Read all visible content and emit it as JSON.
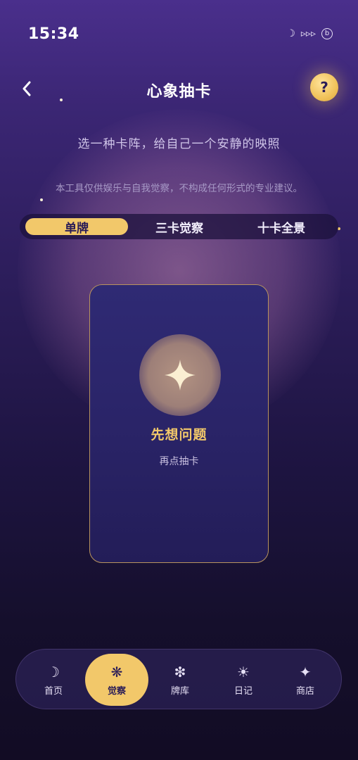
{
  "status_bar": {
    "time": "15:34",
    "icons": [
      "moon-icon",
      "signal-icon",
      "battery-icon"
    ],
    "battery_glyph": "b",
    "signal_glyph": "▹▹▹"
  },
  "header": {
    "title": "心象抽卡",
    "help_label": "?"
  },
  "subtitle": "选一种卡阵，给自己一个安静的映照",
  "disclaimer": "本工具仅供娱乐与自我觉察，不构成任何形式的专业建议。",
  "tabs": [
    {
      "label": "单牌",
      "active": true
    },
    {
      "label": "三卡觉察",
      "active": false
    },
    {
      "label": "十卡全景",
      "active": false
    }
  ],
  "card": {
    "title": "先想问题",
    "subtitle": "再点抽卡",
    "icon": "sparkle-icon"
  },
  "bottom_nav": [
    {
      "label": "首页",
      "icon": "moon-icon",
      "glyph": "☽",
      "active": false
    },
    {
      "label": "觉察",
      "icon": "asterisk-icon",
      "glyph": "❋",
      "active": true
    },
    {
      "label": "牌库",
      "icon": "snowflake-icon",
      "glyph": "❇",
      "active": false
    },
    {
      "label": "日记",
      "icon": "sun-icon",
      "glyph": "☀",
      "active": false
    },
    {
      "label": "商店",
      "icon": "star-icon",
      "glyph": "✦",
      "active": false
    }
  ],
  "colors": {
    "accent": "#f2c86a",
    "background_top": "#4a2f8c",
    "background_bottom": "#120c24",
    "card_border": "#b8935e"
  }
}
